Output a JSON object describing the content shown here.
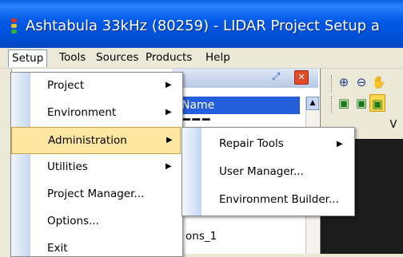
{
  "window": {
    "title": "Ashtabula 33kHz (80259)  -  LIDAR Project Setup a",
    "title_icon": "traffic-light-icon"
  },
  "menubar": {
    "items": [
      {
        "label": "Setup",
        "active": true
      },
      {
        "label": "Tools"
      },
      {
        "label": "Sources"
      },
      {
        "label": "Products"
      },
      {
        "label": "Help"
      }
    ]
  },
  "setup_menu": {
    "items": [
      {
        "label": "Project",
        "submenu": true
      },
      {
        "label": "Environment",
        "submenu": true
      },
      {
        "label": "Administration",
        "submenu": true,
        "highlighted": true
      },
      {
        "label": "Utilities",
        "submenu": true
      },
      {
        "label": "Project Manager..."
      },
      {
        "label": "Options..."
      },
      {
        "label": "Exit"
      }
    ]
  },
  "admin_submenu": {
    "items": [
      {
        "label": "Repair Tools",
        "submenu": true
      },
      {
        "label": "User Manager..."
      },
      {
        "label": "Environment Builder..."
      }
    ]
  },
  "panel": {
    "column_header": "Name",
    "partial_row_text": "ons_1",
    "pin_icon": "pin-icon",
    "close_icon": "close-icon"
  },
  "right_panel": {
    "tab_partial": "V"
  },
  "colors": {
    "titlebar": "#0058e6",
    "highlight": "#ffe7a2",
    "header": "#245edb"
  }
}
